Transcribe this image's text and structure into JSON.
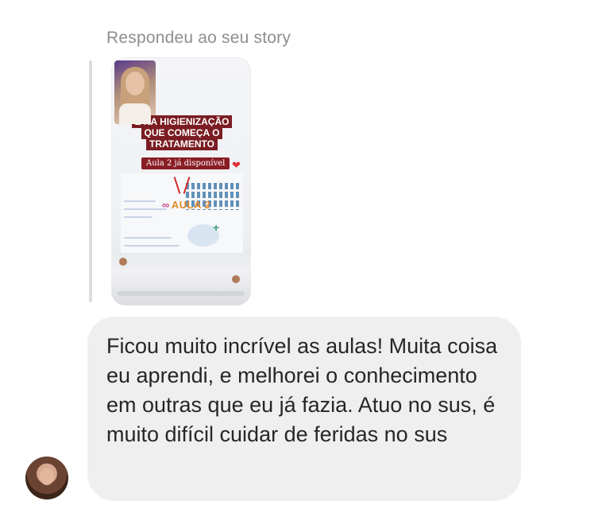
{
  "reply_label": "Respondeu ao seu story",
  "story": {
    "title_lines": [
      "É NA HIGIENIZAÇÃO",
      "QUE COMEÇA O",
      "TRATAMENTO"
    ],
    "badge": "Aula 2 já disponível",
    "logo_text": "AULA 2"
  },
  "message": {
    "text": "Ficou muito incrível as aulas! Muita coisa eu aprendi, e melhorei o conhecimento em outras que eu já fazia. Atuo no sus, é muito difícil cuidar de feridas no sus"
  },
  "colors": {
    "bubble": "#efefef",
    "label": "#8e8e93",
    "text": "#262626",
    "story_banner": "#7a1d22"
  },
  "icons": {
    "heart": "heart-icon",
    "avatar": "sender-avatar"
  }
}
